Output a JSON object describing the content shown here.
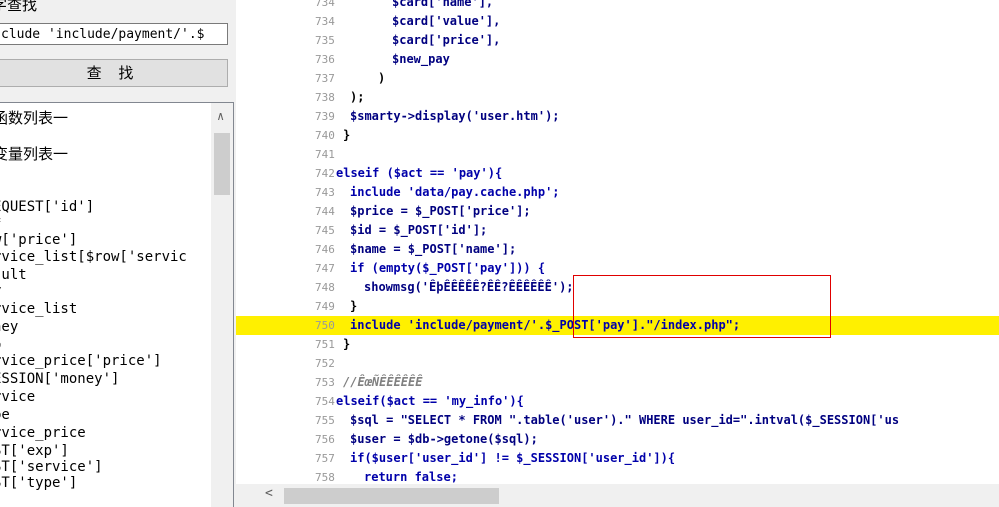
{
  "left": {
    "title": "字查找",
    "search_value": "clude 'include/payment/'.$",
    "find_button": "查 找",
    "list_items": [
      "函数列表一",
      "变量列表一",
      "",
      "EQUEST['id']",
      "f",
      "w['price']",
      "rvice_list[$row['servic",
      "sult",
      "y",
      "rvice_list",
      "ney",
      "o",
      "rvice_price['price']",
      "ESSION['money']",
      "rvice",
      "pe",
      "rvice_price",
      "ST['exp']",
      "ST['service']",
      "ST['type']"
    ]
  },
  "code": {
    "lines": [
      {
        "no": "734",
        "text": "$card['name'],"
      },
      {
        "no": "734",
        "text": "$card['value'],"
      },
      {
        "no": "735",
        "text": "$card['price'],"
      },
      {
        "no": "736",
        "text": "$new_pay"
      },
      {
        "no": "737",
        "text": ")"
      },
      {
        "no": "738",
        "text": ");"
      },
      {
        "no": "739",
        "text": "$smarty->display('user.htm');"
      },
      {
        "no": "740",
        "text": "}"
      },
      {
        "no": "741",
        "text": ""
      },
      {
        "no": "742",
        "text": "elseif ($act == 'pay'){"
      },
      {
        "no": "743",
        "text": "include 'data/pay.cache.php';"
      },
      {
        "no": "744",
        "text": "$price = $_POST['price'];"
      },
      {
        "no": "745",
        "text": "$id = $_POST['id'];"
      },
      {
        "no": "746",
        "text": "$name = $_POST['name'];"
      },
      {
        "no": "747",
        "text": "if (empty($_POST['pay'])) {"
      },
      {
        "no": "748",
        "text": "showmsg('ÊþÊÊÊÊÊ?ÊÊ?ÊÊÊÊÊÊ');"
      },
      {
        "no": "749",
        "text": "}"
      },
      {
        "no": "750",
        "text": "include 'include/payment/'.$_POST['pay'].\"/index.php\";"
      },
      {
        "no": "751",
        "text": "}"
      },
      {
        "no": "752",
        "text": ""
      },
      {
        "no": "753",
        "text": "//ÊœÑÊÊÊÊÊÊ"
      },
      {
        "no": "754",
        "text": "elseif($act == 'my_info'){"
      },
      {
        "no": "755",
        "text": "$sql = \"SELECT * FROM \".table('user').\" WHERE user_id=\".intval($_SESSION['us"
      },
      {
        "no": "756",
        "text": "$user = $db->getone($sql);"
      },
      {
        "no": "757",
        "text": "if($user['user_id'] != $_SESSION['user_id']){"
      },
      {
        "no": "758",
        "text": "return false;"
      },
      {
        "no": "759",
        "text": "}"
      }
    ]
  },
  "colors": {
    "highlight": "#fff000",
    "box": "#e00000",
    "keyword": "#0000aa",
    "string": "#ff00ff"
  }
}
